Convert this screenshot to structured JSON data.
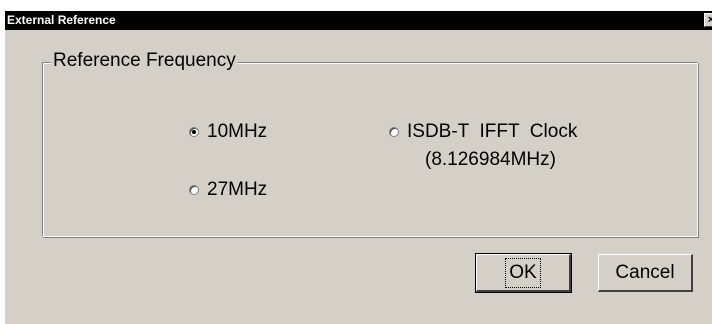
{
  "window": {
    "title": "External Reference",
    "close_glyph": "×"
  },
  "group": {
    "label": "Reference Frequency",
    "options": [
      {
        "label": "10MHz",
        "selected": true
      },
      {
        "label": "27MHz",
        "selected": false
      },
      {
        "label": "ISDB-T  IFFT  Clock",
        "sublabel": "(8.126984MHz)",
        "selected": false
      }
    ]
  },
  "buttons": {
    "ok": "OK",
    "cancel": "Cancel"
  }
}
